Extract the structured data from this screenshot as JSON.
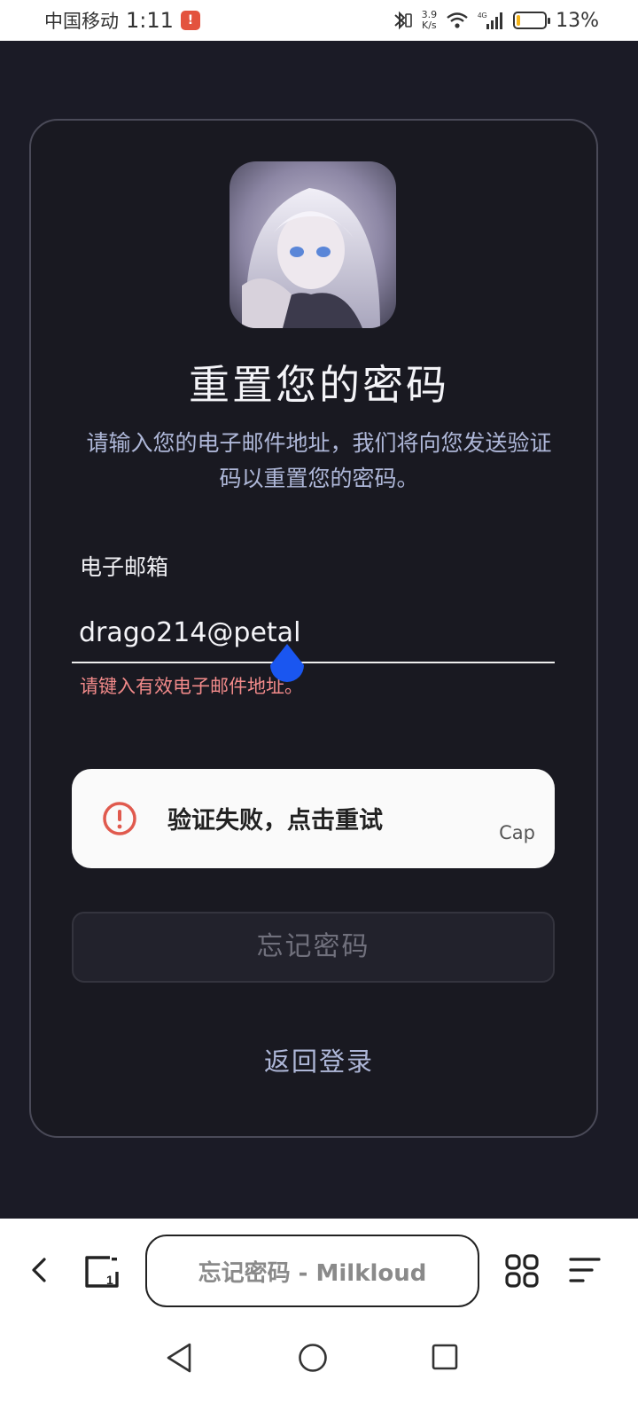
{
  "status_bar": {
    "carrier": "中国移动",
    "time": "1:11",
    "notification_badge": "!",
    "net_speed_value": "3.9",
    "net_speed_unit": "K/s",
    "battery_percent": "13%",
    "battery_level": 0.13
  },
  "form": {
    "title": "重置您的密码",
    "subtitle": "请输入您的电子邮件地址，我们将向您发送验证码以重置您的密码。",
    "email_label": "电子邮箱",
    "email_value": "drago214@petal",
    "email_error": "请键入有效电子邮件地址。",
    "captcha_message": "验证失败，点击重试",
    "captcha_brand": "Cap",
    "submit_label": "忘记密码",
    "back_link": "返回登录"
  },
  "browser": {
    "url_title": "忘记密码 - Milkloud"
  },
  "icons": {
    "captcha_status": "error-icon",
    "avatar": "anime-avatar"
  },
  "colors": {
    "background": "#1b1b26",
    "accent_text": "#aeb7d8",
    "error": "#f28a8a",
    "captcha_error": "#e05a4e",
    "battery": "#f4b41a"
  }
}
